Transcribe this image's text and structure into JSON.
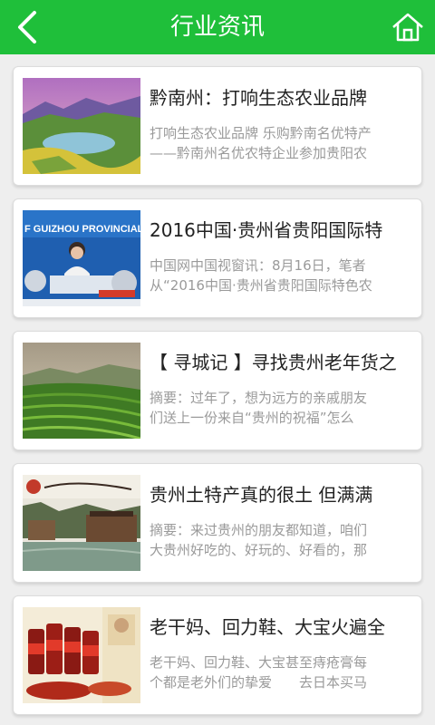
{
  "header": {
    "title": "行业资讯",
    "back_icon": "back-arrow-icon",
    "home_icon": "home-icon",
    "bar_color": "#1fbf3a"
  },
  "articles": [
    {
      "title": "黔南州：打响生态农业品牌",
      "summary_line1": "打响生态农业品牌 乐购黔南名优特产",
      "summary_line2": "——黔南州名优农特企业参加贵阳农",
      "image": "landscape-lake-photo"
    },
    {
      "title": "2016中国·贵州省贵阳国际特",
      "summary_line1": "中国网中国视窗讯：8月16日，笔者",
      "summary_line2": "从“2016中国·贵州省贵阳国际特色农",
      "image": "press-conference-photo",
      "image_banner_text": "F GUIZHOU PROVINCIAL"
    },
    {
      "title": "【 寻城记 】寻找贵州老年货之",
      "summary_line1": "摘要：过年了，想为远方的亲戚朋友",
      "summary_line2": "们送上一份来自“贵州的祝福”怎么",
      "image": "tea-plantation-photo"
    },
    {
      "title": "贵州土特产真的很土 但满满",
      "summary_line1": "摘要：来过贵州的朋友都知道，咱们",
      "summary_line2": "大贵州好吃的、好玩的、好看的，那",
      "image": "riverside-town-photo"
    },
    {
      "title": "老干妈、回力鞋、大宝火遍全",
      "summary_line1": "老干妈、回力鞋、大宝甚至痔疮膏每",
      "summary_line2": "个都是老外们的挚爱　　去日本买马",
      "image": "chili-sauce-jars-photo"
    }
  ]
}
